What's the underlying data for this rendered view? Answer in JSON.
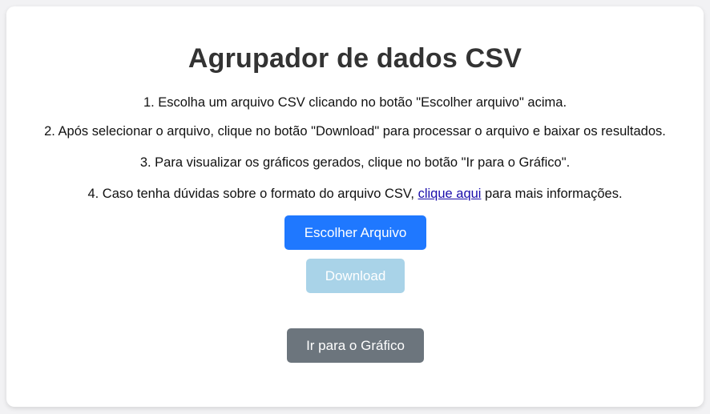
{
  "title": "Agrupador de dados CSV",
  "steps": {
    "s1": "1. Escolha um arquivo CSV clicando no botão \"Escolher arquivo\" acima.",
    "s2": "2. Após selecionar o arquivo, clique no botão \"Download\" para processar o arquivo e baixar os resultados.",
    "s3": "3. Para visualizar os gráficos gerados, clique no botão \"Ir para o Gráfico\".",
    "s4_before": "4. Caso tenha dúvidas sobre o formato do arquivo CSV, ",
    "s4_link": "clique aqui",
    "s4_after": " para mais informações."
  },
  "buttons": {
    "choose_file": "Escolher Arquivo",
    "download": "Download",
    "go_chart": "Ir para o Gráfico"
  },
  "colors": {
    "primary": "#1f78ff",
    "download_disabled": "#a9d3e8",
    "secondary": "#6c757d",
    "link": "#1a0dab"
  }
}
